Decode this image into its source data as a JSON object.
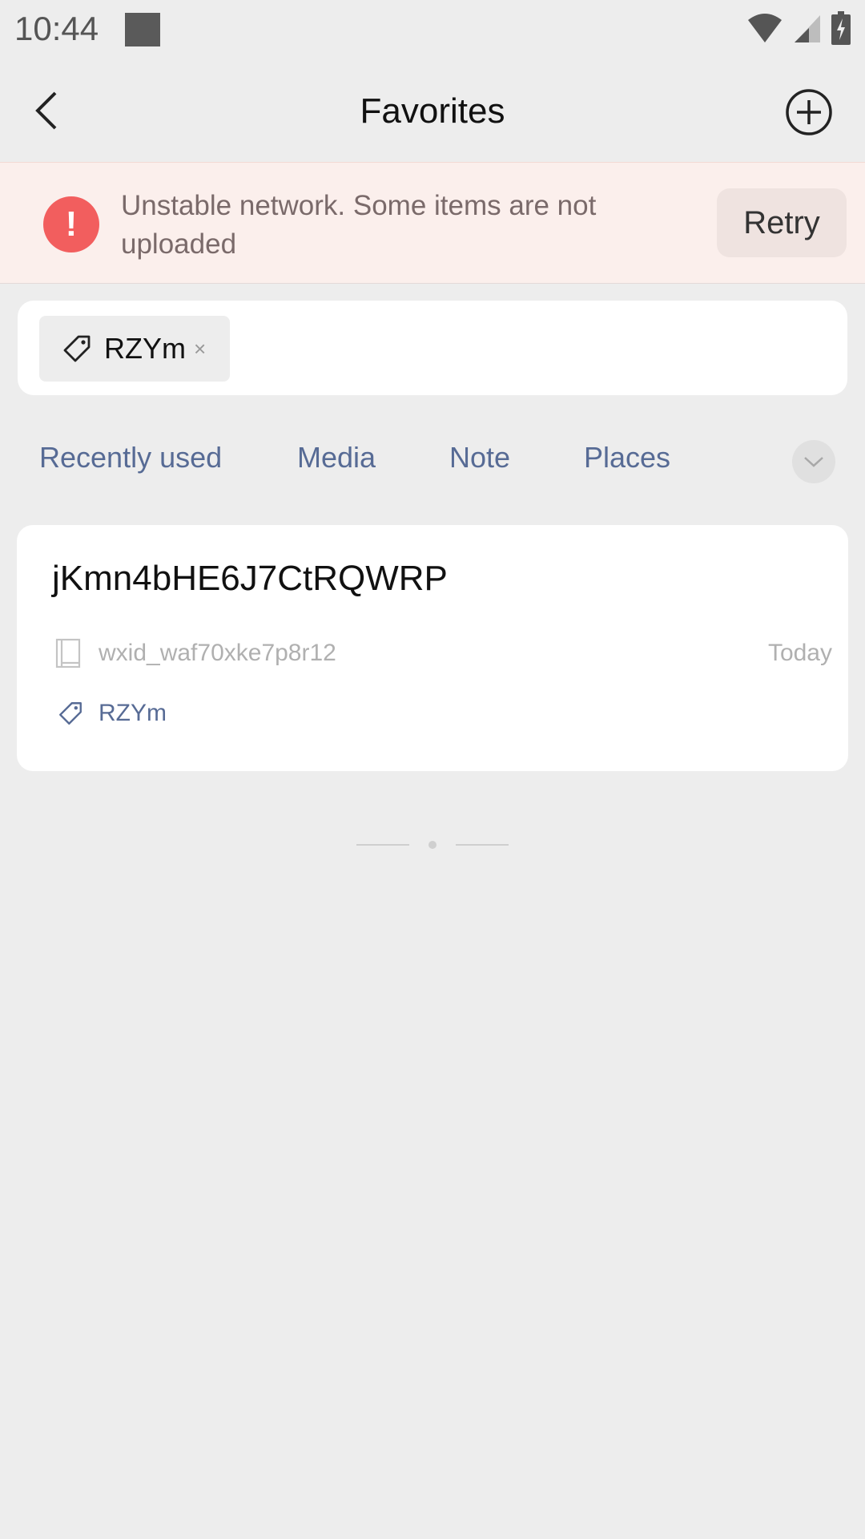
{
  "status_bar": {
    "time": "10:44",
    "icons": [
      "wifi-icon",
      "cell-signal-icon",
      "battery-charging-icon"
    ]
  },
  "nav": {
    "title": "Favorites",
    "back_icon": "chevron-left-icon",
    "add_icon": "plus-circle-icon"
  },
  "alert": {
    "message": "Unstable network. Some items are not uploaded",
    "icon_glyph": "!",
    "retry_label": "Retry",
    "color": "#f25e5e"
  },
  "filter": {
    "tag_label": "RZYm",
    "remove_glyph": "×"
  },
  "categories": [
    {
      "label": "Recently used"
    },
    {
      "label": "Media"
    },
    {
      "label": "Note"
    },
    {
      "label": "Places"
    }
  ],
  "favorites": [
    {
      "title": "jKmn4bHE6J7CtRQWRP",
      "source": "wxid_waf70xke7p8r12",
      "date": "Today",
      "tag": "RZYm"
    }
  ],
  "colors": {
    "link": "#576b95",
    "background": "#ededed"
  }
}
